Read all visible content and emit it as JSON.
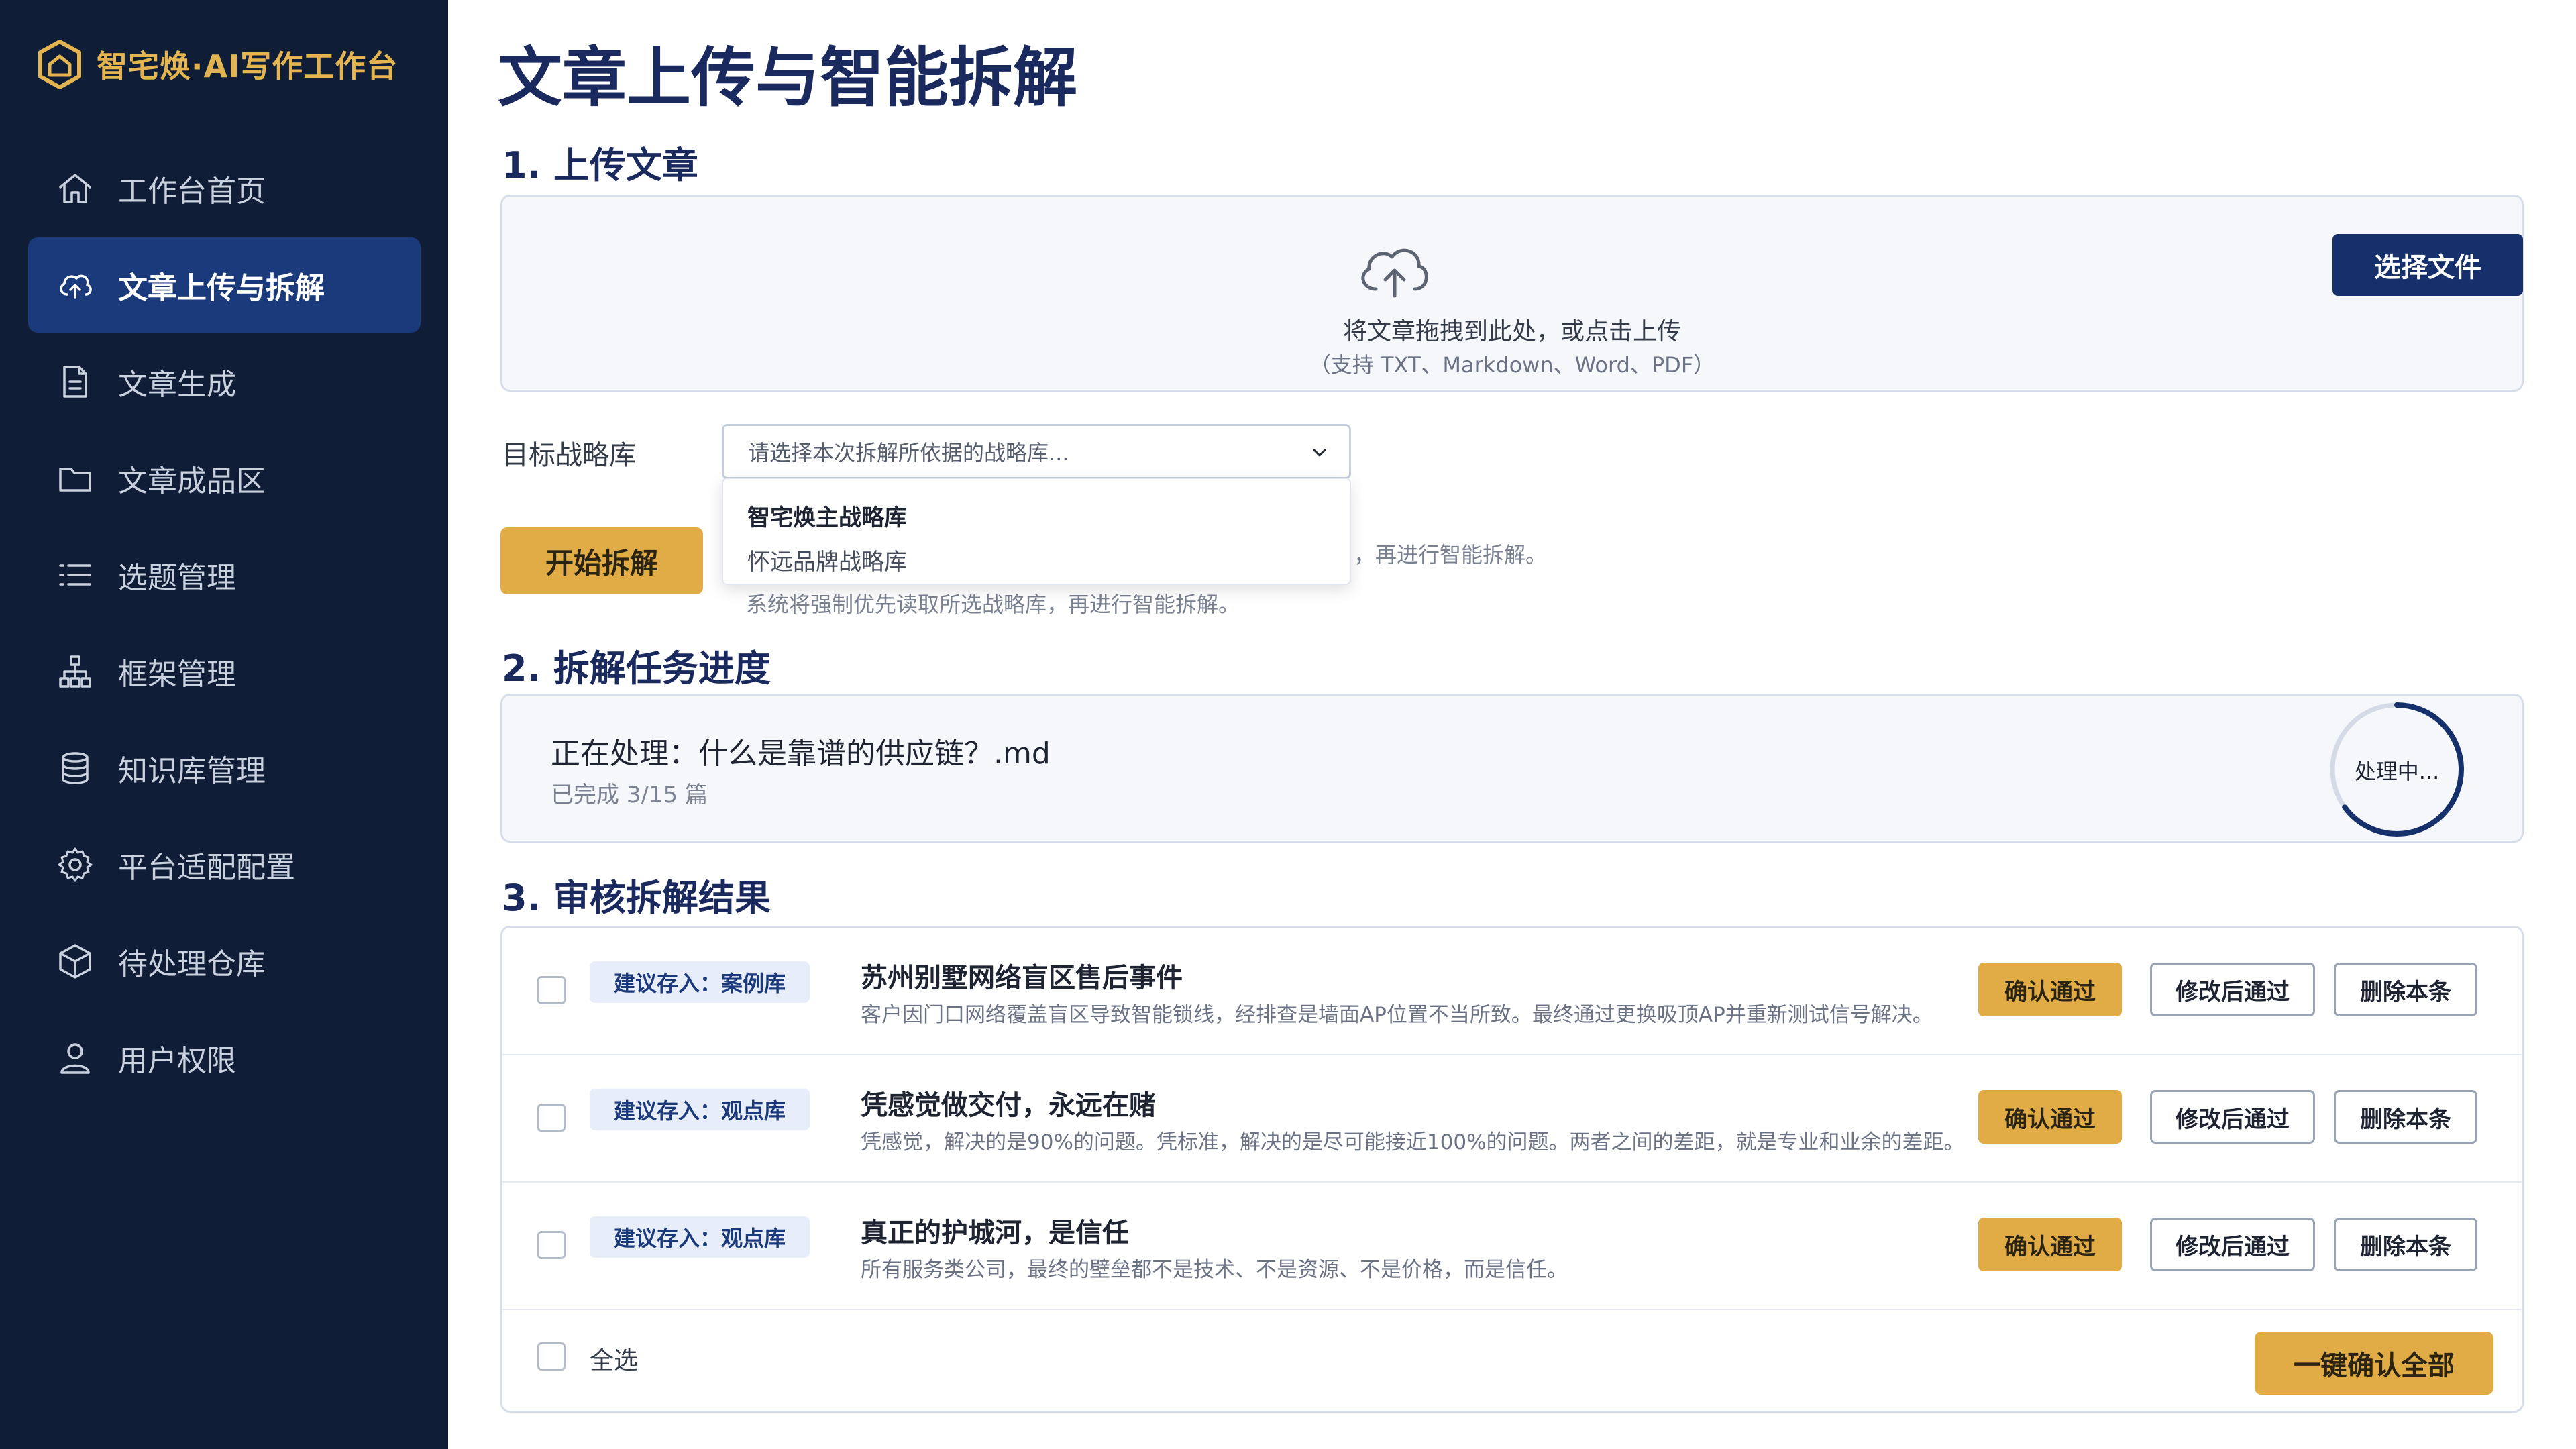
{
  "brand": {
    "name": "智宅焕·AI写作工作台"
  },
  "sidebar": {
    "items": [
      {
        "label": "工作台首页",
        "icon": "home-icon"
      },
      {
        "label": "文章上传与拆解",
        "icon": "cloud-upload-icon",
        "active": true
      },
      {
        "label": "文章生成",
        "icon": "document-icon"
      },
      {
        "label": "文章成品区",
        "icon": "folder-icon"
      },
      {
        "label": "选题管理",
        "icon": "list-icon"
      },
      {
        "label": "框架管理",
        "icon": "hierarchy-icon"
      },
      {
        "label": "知识库管理",
        "icon": "database-icon"
      },
      {
        "label": "平台适配配置",
        "icon": "gear-icon"
      },
      {
        "label": "待处理仓库",
        "icon": "box-icon"
      },
      {
        "label": "用户权限",
        "icon": "user-icon"
      }
    ]
  },
  "page": {
    "title": "文章上传与智能拆解"
  },
  "upload": {
    "section_title": "1. 上传文章",
    "drop_text": "将文章拖拽到此处，或点击上传",
    "formats": "（支持 TXT、Markdown、Word、PDF）",
    "choose_button": "选择文件",
    "library_label": "目标战略库",
    "library_placeholder": "请选择本次拆解所依据的战略库...",
    "library_options": [
      "智宅焕主战略库",
      "怀远品牌战略库"
    ],
    "start_button": "开始拆解",
    "hint_peek": "，再进行智能拆解。",
    "hint": "系统将强制优先读取所选战略库，再进行智能拆解。"
  },
  "progress": {
    "section_title": "2. 拆解任务进度",
    "processing_title": "正在处理：什么是靠谱的供应链？.md",
    "completed_text": "已完成 3/15 篇",
    "status_label": "处理中...",
    "completed": 3,
    "total": 15
  },
  "results": {
    "section_title": "3. 审核拆解结果",
    "items": [
      {
        "tag": "建议存入：案例库",
        "title": "苏州别墅网络盲区售后事件",
        "desc": "客户因门口网络覆盖盲区导致智能锁线，经排查是墙面AP位置不当所致。最终通过更换吸顶AP并重新测试信号解决。",
        "confirm": "确认通过",
        "modify": "修改后通过",
        "delete": "删除本条"
      },
      {
        "tag": "建议存入：观点库",
        "title": "凭感觉做交付，永远在赌",
        "desc": "凭感觉，解决的是90%的问题。凭标准，解决的是尽可能接近100%的问题。两者之间的差距，就是专业和业余的差距。",
        "confirm": "确认通过",
        "modify": "修改后通过",
        "delete": "删除本条"
      },
      {
        "tag": "建议存入：观点库",
        "title": "真正的护城河，是信任",
        "desc": "所有服务类公司，最终的壁垒都不是技术、不是资源、不是价格，而是信任。",
        "confirm": "确认通过",
        "modify": "修改后通过",
        "delete": "删除本条"
      }
    ],
    "select_all": "全选",
    "confirm_all": "一键确认全部"
  },
  "colors": {
    "sidebar_bg": "#0f1d36",
    "active_nav": "#1b3a7c",
    "brand_gold": "#e3b450",
    "accent_gold": "#e1ac45",
    "primary_navy": "#15306b"
  }
}
